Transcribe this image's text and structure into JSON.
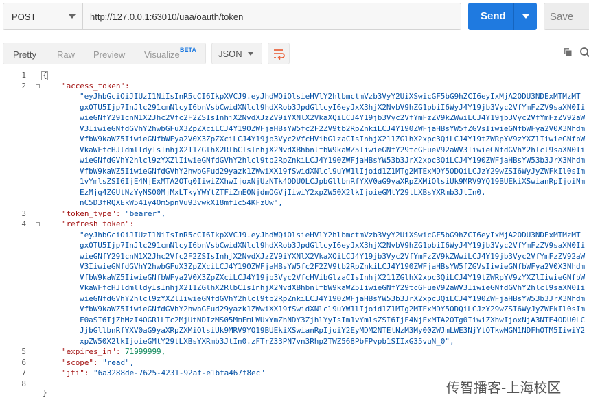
{
  "request": {
    "method": "POST",
    "url": "http://127.0.0.1:63010/uaa/oauth/token",
    "send_label": "Send",
    "save_label": "Save"
  },
  "response_toolbar": {
    "view_tabs": [
      "Pretty",
      "Raw",
      "Preview",
      "Visualize"
    ],
    "visualize_badge": "BETA",
    "format": "JSON"
  },
  "response_body": {
    "line_numbers": [
      "1",
      "2",
      "3",
      "4",
      "5",
      "6",
      "7",
      "8"
    ],
    "open_brace": "{",
    "close_brace": "}",
    "access_token_key": "\"access_token\":",
    "access_token_lines": [
      "\"eyJhbGciOiJIUzI1NiIsInR5cCI6IkpXVCJ9.eyJhdWQiOlsieHVlY2hlbmctmVzb3VyY2UiXSwicGF5bG9hZCI6eyIxMjA2ODU3NDExMTMzMT",
      "gxOTU5Ijp7InJlc291cmNlcyI6bnVsbCwidXNlcl9hdXRob3JpdGllcyI6eyJxX3hjX2NvbV9hZG1pbiI6WyJ4Y19jb3Vyc2VfYmFzZV9saXN0Ii",
      "wieGNfY291cnN1X2Jhc2Vfc2F2ZSIsInhjX2NvdXJzZV9iYXNlX2VkaXQiLCJ4Y19jb3Vyc2VfYmFzZV9kZWwiLCJ4Y19jb3Vyc2VfYmFzZV92aW",
      "V3IiwieGNfdGVhY2hwbGFuX3ZpZXciLCJ4Y190ZWFjaHBsYW5fc2F2ZV9tb2RpZnkiLCJ4Y190ZWFjaHBsYW5fZGVsIiwieGNfbWFya2V0X3Nhdm",
      "VfbW9kaWZ5IiwieGNfbWFya2V0X3ZpZXciLCJ4Y19jb3Vyc2VfcHVibGlzaCIsInhjX211ZGlhX2xpc3QiLCJ4Y19tZWRpYV9zYXZlIiwieGNfbW",
      "VkaWFfcHJldmlldyIsInhjX211ZGlhX2RlbCIsInhjX2NvdXBhbnlfbW9kaWZ5IiwieGNfY29tcGFueV92aWV3IiwieGNfdGVhY2hlcl9saXN0Ii",
      "wieGNfdGVhY2hlcl9zYXZlIiwieGNfdGVhY2hlcl9tb2RpZnkiLCJ4Y190ZWFjaHBsYW53b3JrX2xpc3QiLCJ4Y190ZWFjaHBsYW53b3JrX3Nhdm",
      "VfbW9kaWZ5IiwieGNfdGVhY2hwbGFud29yazk1ZWwiXX19fSwidXNlcl9uYW1lIjoid1Z1MTg2MTExMDY5ODQiLCJzY29wZSI6WyJyZWFkIl0sIm",
      "1vYmlsZSI6IjE4NjExMTA2OTg0IiwiZXhwIjoxNjUzNTk4ODU0LCJpbGllbnRfYXV0aG9yaXRpZXMiOlsiUk9MRV9YQ19BUEkiXSwianRpIjoiNm",
      "EzMjg4ZGUtNzYyNS00MjMxLTkyYWYtZTFiZmE0NjdmOGVjIiwiY2xpZW50X2lkIjoieGMtY29tLXBsYXRmb3JtIn0.",
      "nC5D3fRQXEkW541y4Om5pnVu93vwkX18mfIc54KFzUw\","
    ],
    "token_type_key": "\"token_type\":",
    "token_type_value": "\"bearer\",",
    "refresh_token_key": "\"refresh_token\":",
    "refresh_token_lines": [
      "\"eyJhbGciOiJIUzI1NiIsInR5cCI6IkpXVCJ9.eyJhdWQiOlsieHVlY2hlbmctmVzb3VyY2UiXSwicGF5bG9hZCI6eyIxMjA2ODU3NDExMTMzMT",
      "gxOTU5Ijp7InJlc291cmNlcyI6bnVsbCwidXNlcl9hdXRob3JpdGllcyI6eyJxX3hjX2NvbV9hZG1pbiI6WyJ4Y19jb3Vyc2VfYmFzZV9saXN0Ii",
      "wieGNfY291cnN1X2Jhc2Vfc2F2ZSIsInhjX2NvdXJzZV9iYXNlX2VkaXQiLCJ4Y19jb3Vyc2VfYmFzZV9kZWwiLCJ4Y19jb3Vyc2VfYmFzZV92aW",
      "V3IiwieGNfdGVhY2hwbGFuX3ZpZXciLCJ4Y190ZWFjaHBsYW5fc2F2ZV9tb2RpZnkiLCJ4Y190ZWFjaHBsYW5fZGVsIiwieGNfbWFya2V0X3Nhdm",
      "VfbW9kaWZ5IiwieGNfbWFya2V0X3ZpZXciLCJ4Y19jb3Vyc2VfcHVibGlzaCIsInhjX211ZGlhX2xpc3QiLCJ4Y19tZWRpYV9zYXZlIiwieGNfbW",
      "VkaWFfcHJldmlldyIsInhjX211ZGlhX2RlbCIsInhjX2NvdXBhbnlfbW9kaWZ5IiwieGNfY29tcGFueV92aWV3IiwieGNfdGVhY2hlcl9saXN0Ii",
      "wieGNfdGVhY2hlcl9zYXZlIiwieGNfdGVhY2hlcl9tb2RpZnkiLCJ4Y190ZWFjaHBsYW53b3JrX2xpc3QiLCJ4Y190ZWFjaHBsYW53b3JrX3Nhdm",
      "VfbW9kaWZ5IiwieGNfdGVhY2hwbGFud29yazk1ZWwiXX19fSwidXNlcl9uYW1lIjoid1Z1MTg2MTExMDY5ODQiLCJzY29wZSI6WyJyZWFkIl0sIm",
      "F0aSI6IjZhMzI4OGRlLTc2MjUtNDIzMS05MmFmLWUxYmZhNDY3ZjhlYyIsIm1vYmlsZSI6IjE4NjExMTA2OTg0IiwiZXhwIjoxNjA3NTE4ODU0LC",
      "JjbGllbnRfYXV0aG9yaXRpZXMiOlsiUk9MRV9YQ19BUEkiXSwianRpIjoiY2EyMDM2NTEtNzM3My00ZWJmLWE3NjYtOTkwMGN1NDFhOTM5IiwiY2",
      "xpZW50X2lkIjoieGMtY29tLXBsYXRmb3JtIn0.zFTrZ33PN7vn3Rhp2TWZ568PbFPvpb1SIIxG35vuN_0\","
    ],
    "expires_in_key": "\"expires_in\":",
    "expires_in_value": "71999999,",
    "scope_key": "\"scope\":",
    "scope_value": "\"read\",",
    "jti_key": "\"jti\":",
    "jti_value": "\"6a3288de-7625-4231-92af-e1bfa467f8ec\""
  },
  "watermark": "传智播客-上海校区",
  "colors": {
    "send_button": "#1f7ae0",
    "json_key": "#a31515",
    "json_string": "#0451a5",
    "json_number": "#098658"
  },
  "icons": [
    "method-dropdown-chevron-icon",
    "send-dropdown-chevron-icon",
    "wrap-lines-icon",
    "copy-icon",
    "search-icon"
  ]
}
